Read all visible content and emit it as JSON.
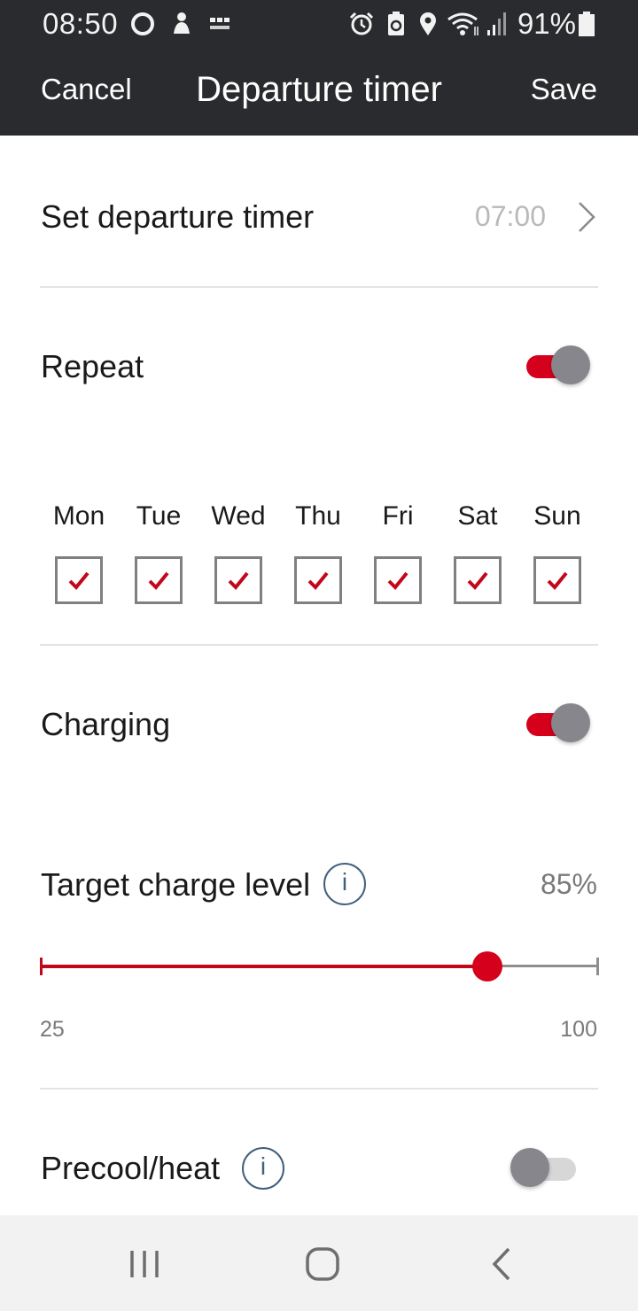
{
  "status_bar": {
    "time": "08:50",
    "battery": "91%",
    "icons": [
      "circle-icon",
      "person-icon",
      "bbc-news-icon",
      "alarm-icon",
      "battery-saver-icon",
      "location-icon",
      "wifi-icon",
      "signal-icon",
      "battery-icon"
    ]
  },
  "header": {
    "cancel": "Cancel",
    "title": "Departure timer",
    "save": "Save"
  },
  "timer": {
    "label": "Set departure timer",
    "value": "07:00"
  },
  "repeat": {
    "label": "Repeat",
    "on": true
  },
  "days": [
    {
      "name": "Mon",
      "checked": true
    },
    {
      "name": "Tue",
      "checked": true
    },
    {
      "name": "Wed",
      "checked": true
    },
    {
      "name": "Thu",
      "checked": true
    },
    {
      "name": "Fri",
      "checked": true
    },
    {
      "name": "Sat",
      "checked": true
    },
    {
      "name": "Sun",
      "checked": true
    }
  ],
  "charging": {
    "label": "Charging",
    "on": true
  },
  "target_charge": {
    "label": "Target charge level",
    "value_text": "85%",
    "value": 85,
    "min": "25",
    "max": "100"
  },
  "precool": {
    "label": "Precool/heat",
    "on": false
  },
  "colors": {
    "accent": "#d5001c",
    "header_bg": "#2a2b2e",
    "info": "#41607e"
  },
  "info_icon_text": "i"
}
